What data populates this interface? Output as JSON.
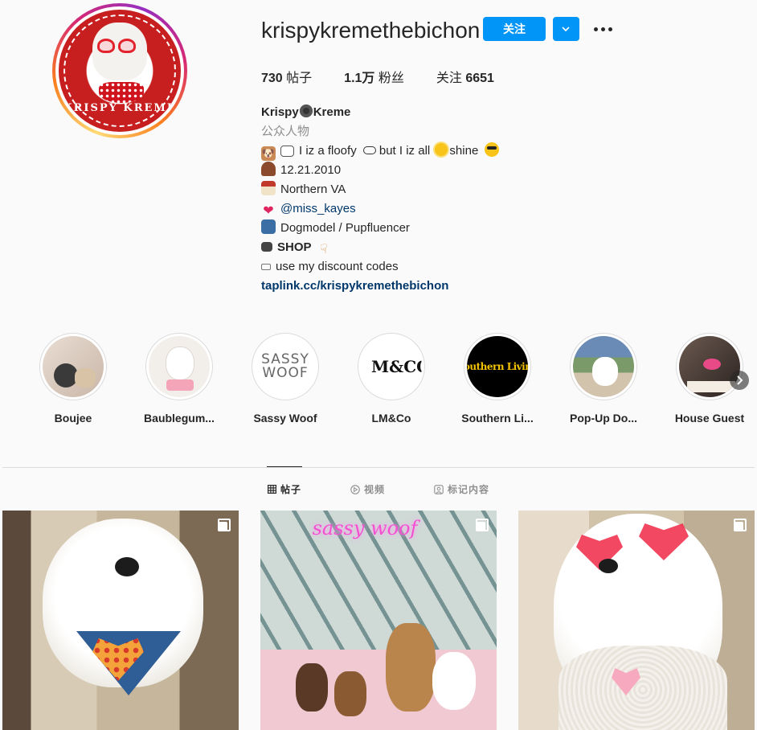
{
  "profile": {
    "username": "krispykremethebichon",
    "avatar_text": "KRISPY KREME",
    "follow_label": "关注",
    "stats": [
      {
        "num": "730",
        "label": "帖子"
      },
      {
        "num": "1.1万",
        "label": "粉丝"
      },
      {
        "num": "6651",
        "label": "关注",
        "prefix": true
      }
    ],
    "bio": {
      "name_a": "Krispy",
      "name_b": "Kreme",
      "category": "公众人物",
      "line1": "I iz a floofy",
      "line1b": "but I iz all",
      "line1c": "shine",
      "birthday": "12.21.2010",
      "location": "Northern VA",
      "mention": "@miss_kayes",
      "job": "Dogmodel / Pupfluencer",
      "shop": "SHOP",
      "discount": "use my discount codes",
      "link": "taplink.cc/krispykremethebichon"
    }
  },
  "highlights": [
    {
      "label": "Boujee"
    },
    {
      "label": "Baublegum..."
    },
    {
      "label": "Sassy Woof",
      "thumb_text": "SASSY WOOF"
    },
    {
      "label": "LM&Co",
      "thumb_text": "M&CO."
    },
    {
      "label": "Southern Li...",
      "thumb_text": "Southern Living"
    },
    {
      "label": "Pop-Up Do..."
    },
    {
      "label": "House Guest"
    }
  ],
  "tabs": [
    {
      "label": "帖子",
      "active": true
    },
    {
      "label": "视频",
      "active": false
    },
    {
      "label": "标记内容",
      "active": false
    }
  ],
  "posts": [
    {
      "overlay_text": ""
    },
    {
      "overlay_text": "sassy woof"
    },
    {
      "overlay_text": ""
    }
  ],
  "colors": {
    "accent": "#0095f6",
    "link": "#00376b",
    "muted": "#8e8e8e"
  }
}
